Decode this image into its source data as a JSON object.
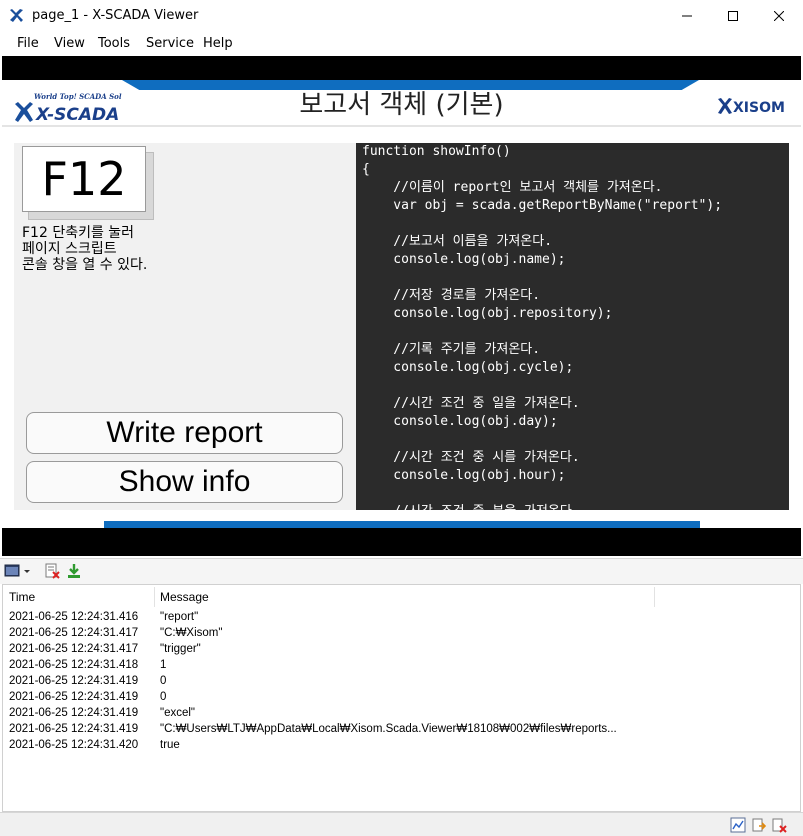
{
  "window": {
    "title": "page_1 - X-SCADA Viewer",
    "minimize_icon": "minimize-icon",
    "maximize_icon": "maximize-icon",
    "close_icon": "close-icon"
  },
  "menu": [
    {
      "label": "File"
    },
    {
      "label": "View"
    },
    {
      "label": "Tools"
    },
    {
      "label": "Service"
    },
    {
      "label": "Help"
    }
  ],
  "page": {
    "title": "보고서 객체 (기본)",
    "logo_left_text": "X-SCADA",
    "logo_left_tagline": "World Top! SCADA Solution",
    "logo_right_text": "XISOM",
    "key_label": "F12",
    "hint_lines": [
      "F12 단축키를 눌러",
      "페이지 스크립트",
      "콘솔 창을 열 수 있다."
    ],
    "write_button": "Write report",
    "show_button": "Show info",
    "accent_color": "#0f6dbf",
    "code_lines": [
      "function showInfo()",
      "{",
      "    //이름이 report인 보고서 객체를 가져온다.",
      "    var obj = scada.getReportByName(\"report\");",
      "",
      "    //보고서 이름을 가져온다.",
      "    console.log(obj.name);",
      "",
      "    //저장 경로를 가져온다.",
      "    console.log(obj.repository);",
      "",
      "    //기록 주기를 가져온다.",
      "    console.log(obj.cycle);",
      "",
      "    //시간 조건 중 일을 가져온다.",
      "    console.log(obj.day);",
      "",
      "    //시간 조건 중 시를 가져온다.",
      "    console.log(obj.hour);",
      "",
      "    //시간 조건 중 분을 가져온다."
    ]
  },
  "console": {
    "headers": {
      "time": "Time",
      "message": "Message"
    },
    "rows": [
      {
        "time": "2021-06-25 12:24:31.416",
        "message": "\"report\""
      },
      {
        "time": "2021-06-25 12:24:31.417",
        "message": "\"C:₩Xisom\""
      },
      {
        "time": "2021-06-25 12:24:31.417",
        "message": "\"trigger\""
      },
      {
        "time": "2021-06-25 12:24:31.418",
        "message": "1"
      },
      {
        "time": "2021-06-25 12:24:31.419",
        "message": "0"
      },
      {
        "time": "2021-06-25 12:24:31.419",
        "message": "0"
      },
      {
        "time": "2021-06-25 12:24:31.419",
        "message": "\"excel\""
      },
      {
        "time": "2021-06-25 12:24:31.419",
        "message": "\"C:₩Users₩LTJ₩AppData₩Local₩Xisom.Scada.Viewer₩18108₩002₩files₩reports..."
      },
      {
        "time": "2021-06-25 12:24:31.420",
        "message": "true"
      }
    ]
  }
}
